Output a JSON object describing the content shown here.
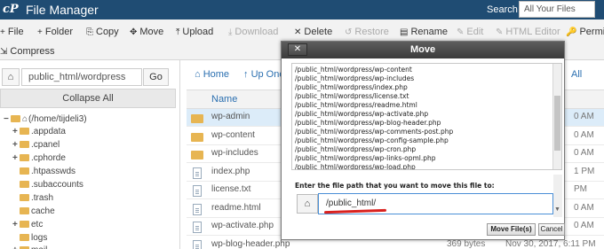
{
  "header": {
    "logo_text": "cP",
    "app_title": "File Manager",
    "search_label": "Search",
    "search_scope": "All Your Files"
  },
  "toolbar": {
    "items": [
      {
        "label": "File",
        "icon": "+",
        "disabled": false
      },
      {
        "label": "Folder",
        "icon": "+",
        "disabled": false
      },
      {
        "label": "Copy",
        "icon": "⎘",
        "disabled": false
      },
      {
        "label": "Move",
        "icon": "✥",
        "disabled": false
      },
      {
        "label": "Upload",
        "icon": "⤒",
        "disabled": false
      },
      {
        "label": "Download",
        "icon": "⤓",
        "disabled": true
      },
      {
        "label": "Delete",
        "icon": "✕",
        "disabled": false
      },
      {
        "label": "Restore",
        "icon": "↺",
        "disabled": true
      },
      {
        "label": "Rename",
        "icon": "▤",
        "disabled": false
      },
      {
        "label": "Edit",
        "icon": "✎",
        "disabled": true
      },
      {
        "label": "HTML Editor",
        "icon": "✎",
        "disabled": true
      },
      {
        "label": "Permi",
        "icon": "🔑",
        "disabled": false
      },
      {
        "label": "Compress",
        "icon": "⇲",
        "disabled": false
      }
    ]
  },
  "left_panel": {
    "path_value": "public_html/wordpress",
    "go_label": "Go",
    "collapse_label": "Collapse All",
    "tree": [
      {
        "label": "(/home/tijdeli3)",
        "expander": "−",
        "is_root": true
      },
      {
        "label": ".appdata",
        "expander": "+"
      },
      {
        "label": ".cpanel",
        "expander": "+"
      },
      {
        "label": ".cphorde",
        "expander": "+"
      },
      {
        "label": ".htpasswds",
        "expander": ""
      },
      {
        "label": ".subaccounts",
        "expander": ""
      },
      {
        "label": ".trash",
        "expander": ""
      },
      {
        "label": "cache",
        "expander": ""
      },
      {
        "label": "etc",
        "expander": "+"
      },
      {
        "label": "logs",
        "expander": ""
      },
      {
        "label": "mail",
        "expander": "+"
      }
    ]
  },
  "file_list": {
    "nav_home": "Home",
    "nav_up": "Up One",
    "nav_all": "All",
    "col_name": "Name",
    "rows": [
      {
        "name": "wp-admin",
        "type": "folder",
        "size": "",
        "date": "",
        "tail": "0 AM",
        "selected": true
      },
      {
        "name": "wp-content",
        "type": "folder",
        "size": "",
        "date": "",
        "tail": "0 AM",
        "selected": false
      },
      {
        "name": "wp-includes",
        "type": "folder",
        "size": "",
        "date": "",
        "tail": "0 AM",
        "selected": false
      },
      {
        "name": "index.php",
        "type": "file",
        "size": "",
        "date": "",
        "tail": "1 PM",
        "selected": false
      },
      {
        "name": "license.txt",
        "type": "file",
        "size": "",
        "date": "",
        "tail": "PM",
        "selected": false
      },
      {
        "name": "readme.html",
        "type": "file",
        "size": "",
        "date": "",
        "tail": "0 AM",
        "selected": false
      },
      {
        "name": "wp-activate.php",
        "type": "file",
        "size": "",
        "date": "",
        "tail": "0 AM",
        "selected": false
      },
      {
        "name": "wp-blog-header.php",
        "type": "file",
        "size": "369 bytes",
        "date": "Nov 30, 2017, 6:11 PM",
        "tail": "",
        "selected": false
      }
    ]
  },
  "move_dialog": {
    "title": "Move",
    "close_label": "✕",
    "files": [
      "/public_html/wordpress/wp-content",
      "/public_html/wordpress/wp-includes",
      "/public_html/wordpress/index.php",
      "/public_html/wordpress/license.txt",
      "/public_html/wordpress/readme.html",
      "/public_html/wordpress/wp-activate.php",
      "/public_html/wordpress/wp-blog-header.php",
      "/public_html/wordpress/wp-comments-post.php",
      "/public_html/wordpress/wp-config-sample.php",
      "/public_html/wordpress/wp-cron.php",
      "/public_html/wordpress/wp-links-opml.php",
      "/public_html/wordpress/wp-load.php"
    ],
    "prompt_label": "Enter the file path that you want to move this file to:",
    "destination_value": "/public_html/",
    "move_button": "Move File(s)",
    "cancel_button": "Cancel"
  }
}
